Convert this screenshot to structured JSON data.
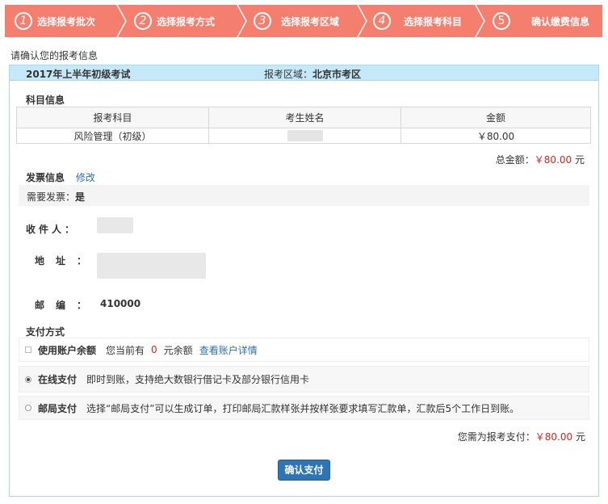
{
  "steps": [
    {
      "num": "1",
      "label": "选择报考批次"
    },
    {
      "num": "2",
      "label": "选择报考方式"
    },
    {
      "num": "3",
      "label": "选择报考区域"
    },
    {
      "num": "4",
      "label": "选择报考科目"
    },
    {
      "num": "5",
      "label": "确认缴费信息"
    }
  ],
  "intro": "请确认您的报考信息",
  "header": {
    "exam": "2017年上半年初级考试",
    "area_label": "报考区域：",
    "area_value": "北京市考区"
  },
  "subjects": {
    "title": "科目信息",
    "columns": [
      "报考科目",
      "考生姓名",
      "金额"
    ],
    "rows": [
      {
        "subject": "风险管理（初级）",
        "name": "",
        "amount": "￥80.00"
      }
    ]
  },
  "total": {
    "label": "总金额：",
    "amount": "￥80.00",
    "unit": "元"
  },
  "invoice": {
    "title": "发票信息",
    "edit_link": "修改",
    "need_label": "需要发票：",
    "need_value": "是"
  },
  "recipient": {
    "receiver_label": "收件人：",
    "address_label": "地址：",
    "zip_label": "邮编：",
    "zip_value": "410000"
  },
  "payment": {
    "title": "支付方式",
    "options": [
      {
        "name": "使用账户余额",
        "desc_before": "您当前有",
        "balance": "0",
        "desc_after": "元余额",
        "link": "查看账户详情",
        "type": "checkbox",
        "selected": false
      },
      {
        "name": "在线支付",
        "desc": "即时到账，支持绝大数银行借记卡及部分银行信用卡",
        "type": "radio",
        "selected": true
      },
      {
        "name": "邮局支付",
        "desc": "选择“邮局支付”可以生成订单，打印邮局汇款样张并按样张要求填写汇款单，汇款后5个工作日到账。",
        "type": "radio",
        "selected": false
      }
    ]
  },
  "need_pay": {
    "label": "您需为报考支付：",
    "amount": "￥80.00",
    "unit": "元"
  },
  "confirm_button": "确认支付",
  "colors": {
    "step_bar": "#f47f6f",
    "panel_header": "#c6e9f9",
    "accent_red": "#d9231b",
    "link_blue": "#2b6fb3",
    "button_blue": "#2e75b6"
  }
}
